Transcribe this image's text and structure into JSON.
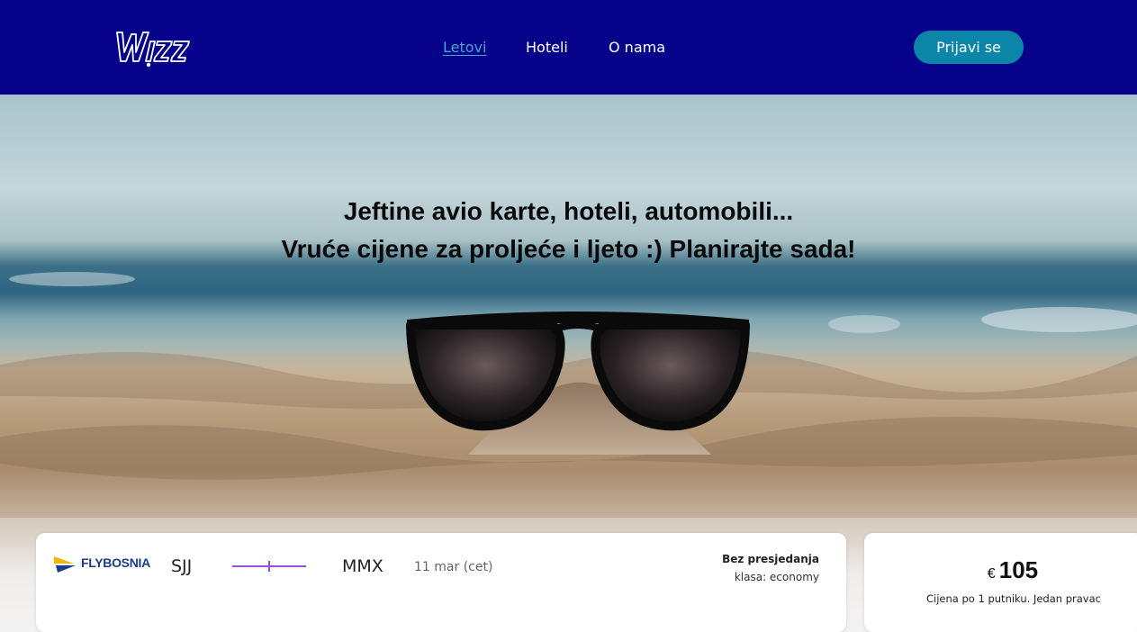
{
  "header": {
    "logo_text": "WIZZ",
    "nav": [
      {
        "label": "Letovi",
        "active": true
      },
      {
        "label": "Hoteli",
        "active": false
      },
      {
        "label": "O nama",
        "active": false
      }
    ],
    "login_label": "Prijavi se"
  },
  "hero": {
    "line1": "Jeftine avio karte, hoteli, automobili...",
    "line2": "Vruće cijene za proljeće i ljeto :) Planirajte sada!"
  },
  "flight": {
    "airline": "FLYBOSNIA",
    "origin": "SJJ",
    "destination": "MMX",
    "date": "11 mar (cet)",
    "stops": "Bez presjedanja",
    "cabin": "klasa: economy"
  },
  "price": {
    "currency": "€",
    "amount": "105",
    "note": "Cijena po 1 putniku. Jedan pravac"
  },
  "colors": {
    "navbar": "#06038a",
    "button": "#0b86a8",
    "active_link": "#4aa3cf",
    "route_line": "#9b4fd6"
  }
}
